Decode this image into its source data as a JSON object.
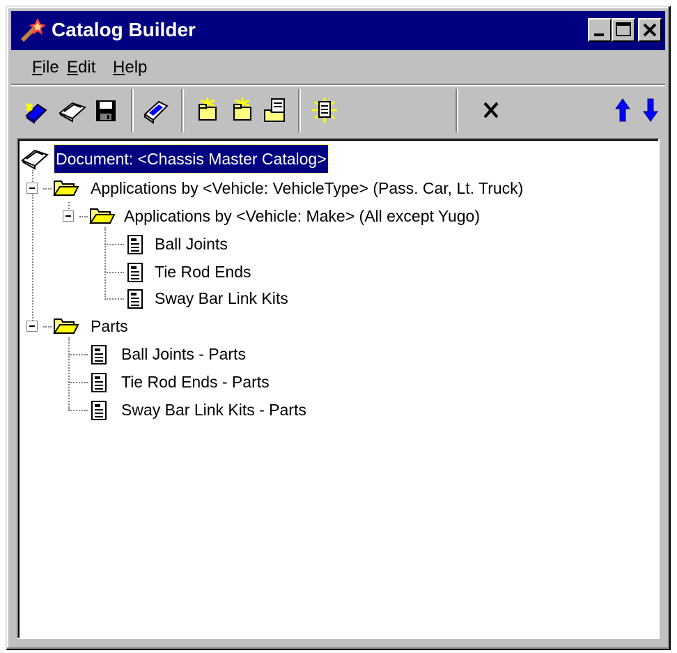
{
  "window": {
    "title": "Catalog Builder"
  },
  "titlebar_buttons": [
    {
      "name": "minimize-button",
      "icon": "minimize-icon"
    },
    {
      "name": "maximize-button",
      "icon": "maximize-icon"
    },
    {
      "name": "close-button",
      "icon": "close-icon"
    }
  ],
  "menu": {
    "file": {
      "mnemonic": "F",
      "rest": "ile"
    },
    "edit": {
      "mnemonic": "E",
      "rest": "dit"
    },
    "help": {
      "mnemonic": "H",
      "rest": "elp"
    }
  },
  "toolbar": [
    {
      "name": "new-catalog-button",
      "icon": "new-catalog-icon"
    },
    {
      "name": "open-catalog-button",
      "icon": "open-book-icon"
    },
    {
      "name": "save-button",
      "icon": "floppy-disk-icon"
    },
    {
      "name": "edit-catalog-button",
      "icon": "edit-book-icon"
    },
    {
      "name": "new-folder-button",
      "icon": "new-folder-icon"
    },
    {
      "name": "new-subfolder-button",
      "icon": "new-folder-icon"
    },
    {
      "name": "folder-properties-button",
      "icon": "folder-document-icon"
    },
    {
      "name": "new-document-button",
      "icon": "new-document-icon"
    },
    {
      "name": "delete-button",
      "icon": "delete-x-icon"
    },
    {
      "name": "move-up-button",
      "icon": "arrow-up-icon"
    },
    {
      "name": "move-down-button",
      "icon": "arrow-down-icon"
    }
  ],
  "tree": {
    "root": "Document: <Chassis Master Catalog>",
    "node1": "Applications by <Vehicle: VehicleType> (Pass. Car, Lt. Truck)",
    "node1_1": "Applications by <Vehicle: Make> (All except Yugo)",
    "leaf1": "Ball Joints",
    "leaf2": "Tie Rod Ends",
    "leaf3": "Sway Bar Link Kits",
    "node2": "Parts",
    "leaf4": "Ball Joints - Parts",
    "leaf5": "Tie Rod Ends - Parts",
    "leaf6": "Sway Bar Link Kits - Parts"
  },
  "colors": {
    "titlebar": "#000080",
    "face": "#c0c0c0",
    "selection": "#000080",
    "folder": "#ffff80",
    "arrow": "#0000ff"
  }
}
